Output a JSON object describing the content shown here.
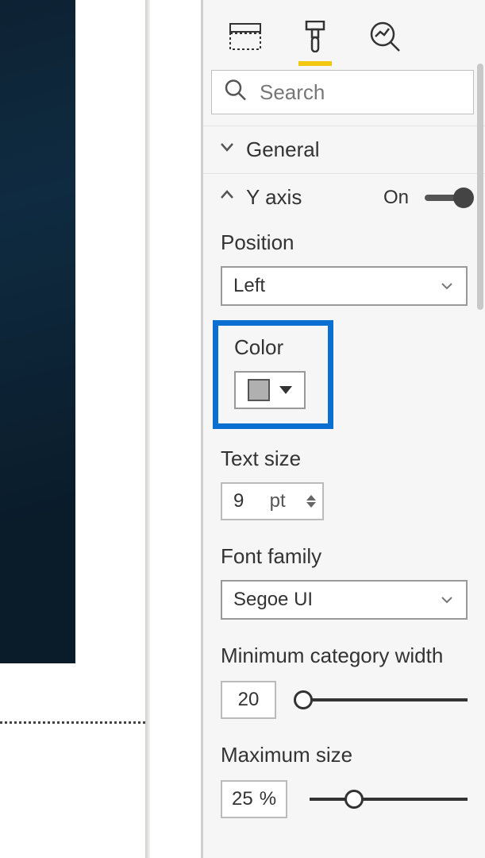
{
  "search": {
    "placeholder": "Search"
  },
  "sections": {
    "general": {
      "label": "General"
    },
    "yaxis": {
      "label": "Y axis",
      "toggle_label": "On"
    }
  },
  "fields": {
    "position": {
      "label": "Position",
      "value": "Left"
    },
    "color": {
      "label": "Color",
      "swatch": "#b0b0b0"
    },
    "text_size": {
      "label": "Text size",
      "value": "9",
      "unit": "pt"
    },
    "font_family": {
      "label": "Font family",
      "value": "Segoe UI"
    },
    "min_category_width": {
      "label": "Minimum category width",
      "value": "20",
      "slider_ratio": 0.03
    },
    "max_size": {
      "label": "Maximum size",
      "value": "25",
      "unit": "%",
      "slider_ratio": 0.28
    }
  }
}
